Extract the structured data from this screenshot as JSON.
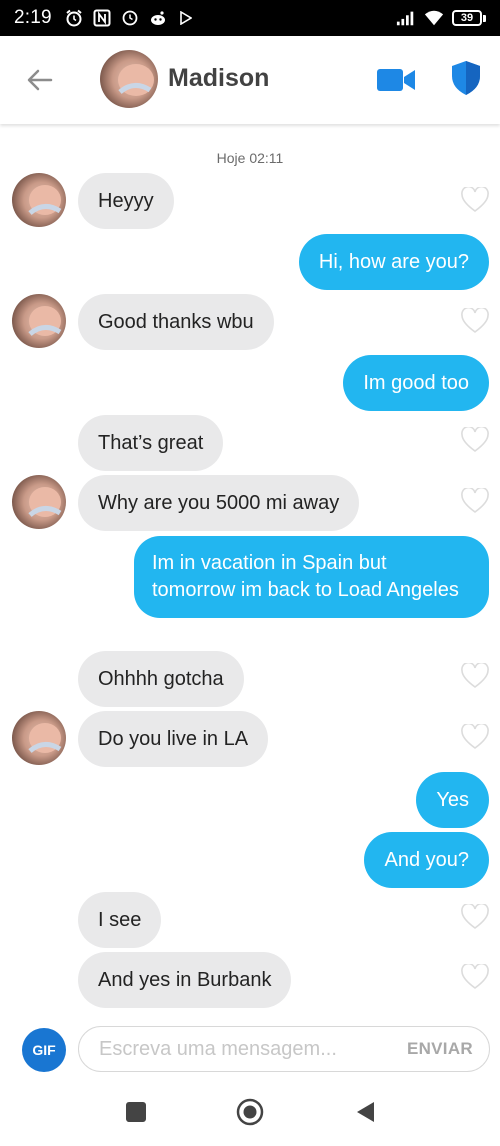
{
  "status_bar": {
    "time": "2:19",
    "battery": "39"
  },
  "header": {
    "contact_name": "Madison"
  },
  "chat": {
    "date_label": "Hoje 02:11",
    "messages": [
      {
        "text": "Heyyy"
      },
      {
        "text": "Hi, how are you?"
      },
      {
        "text": "Good thanks wbu"
      },
      {
        "text": "Im good too"
      },
      {
        "text": "That’s great"
      },
      {
        "text": "Why are you 5000 mi away"
      },
      {
        "text": "Im in vacation in Spain but tomorrow im back to Load Angeles"
      },
      {
        "text": "Ohhhh gotcha"
      },
      {
        "text": "Do you live in LA"
      },
      {
        "text": "Yes"
      },
      {
        "text": "And you?"
      },
      {
        "text": "I see"
      },
      {
        "text": "And yes in Burbank"
      }
    ]
  },
  "composer": {
    "gif_label": "GIF",
    "placeholder": "Escreva uma mensagem...",
    "send_label": "ENVIAR"
  },
  "colors": {
    "accent_blue": "#22b6f0",
    "incoming_bubble": "#e9e9ea",
    "gif_button": "#1976d2",
    "header_icon_blue": "#1e88e5"
  },
  "icons": [
    "back-arrow-icon",
    "video-call-icon",
    "shield-icon",
    "heart-icon",
    "gif-icon",
    "nav-recents-icon",
    "nav-home-icon",
    "nav-back-icon"
  ]
}
